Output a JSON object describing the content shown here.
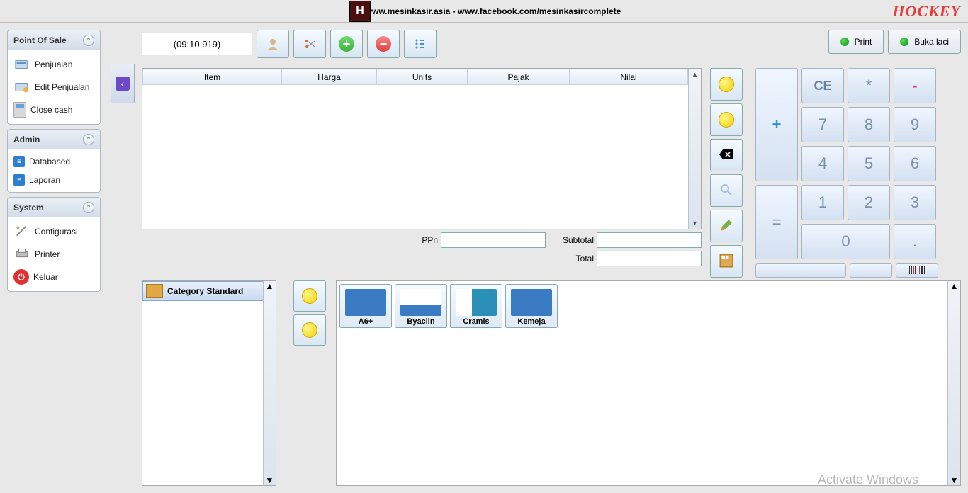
{
  "topbar": {
    "site": "www.mesinkasir.asia - www.facebook.com/mesinkasircomplete",
    "brand": "HOCKEY",
    "logo_letter": "H"
  },
  "sidebar": {
    "pos": {
      "title": "Point Of Sale",
      "items": [
        {
          "label": "Penjualan"
        },
        {
          "label": "Edit Penjualan"
        },
        {
          "label": "Close cash"
        }
      ]
    },
    "admin": {
      "title": "Admin",
      "items": [
        {
          "label": "Databased"
        },
        {
          "label": "Laporan"
        }
      ]
    },
    "system": {
      "title": "System",
      "items": [
        {
          "label": "Configurasi"
        },
        {
          "label": "Printer"
        },
        {
          "label": "Keluar"
        }
      ]
    }
  },
  "toolbar": {
    "time": "(09:10 919)"
  },
  "actions": {
    "print": "Print",
    "drawer": "Buka laci"
  },
  "grid": {
    "headers": [
      "Item",
      "Harga",
      "Units",
      "Pajak",
      "Nilai"
    ]
  },
  "totals": {
    "ppn": "PPn",
    "subtotal": "Subtotal",
    "total": "Total",
    "ppn_val": "",
    "subtotal_val": "",
    "total_val": ""
  },
  "keypad": {
    "ce": "CE",
    "star": "*",
    "minus": "-",
    "plus": "+",
    "equals": "=",
    "k7": "7",
    "k8": "8",
    "k9": "9",
    "k4": "4",
    "k5": "5",
    "k6": "6",
    "k1": "1",
    "k2": "2",
    "k3": "3",
    "k0": "0",
    "kdot": "."
  },
  "category": {
    "selected": "Category Standard"
  },
  "products": [
    {
      "label": "A6+"
    },
    {
      "label": "Byaclin"
    },
    {
      "label": "Cramis"
    },
    {
      "label": "Kemeja"
    }
  ],
  "watermark": "Activate Windows"
}
